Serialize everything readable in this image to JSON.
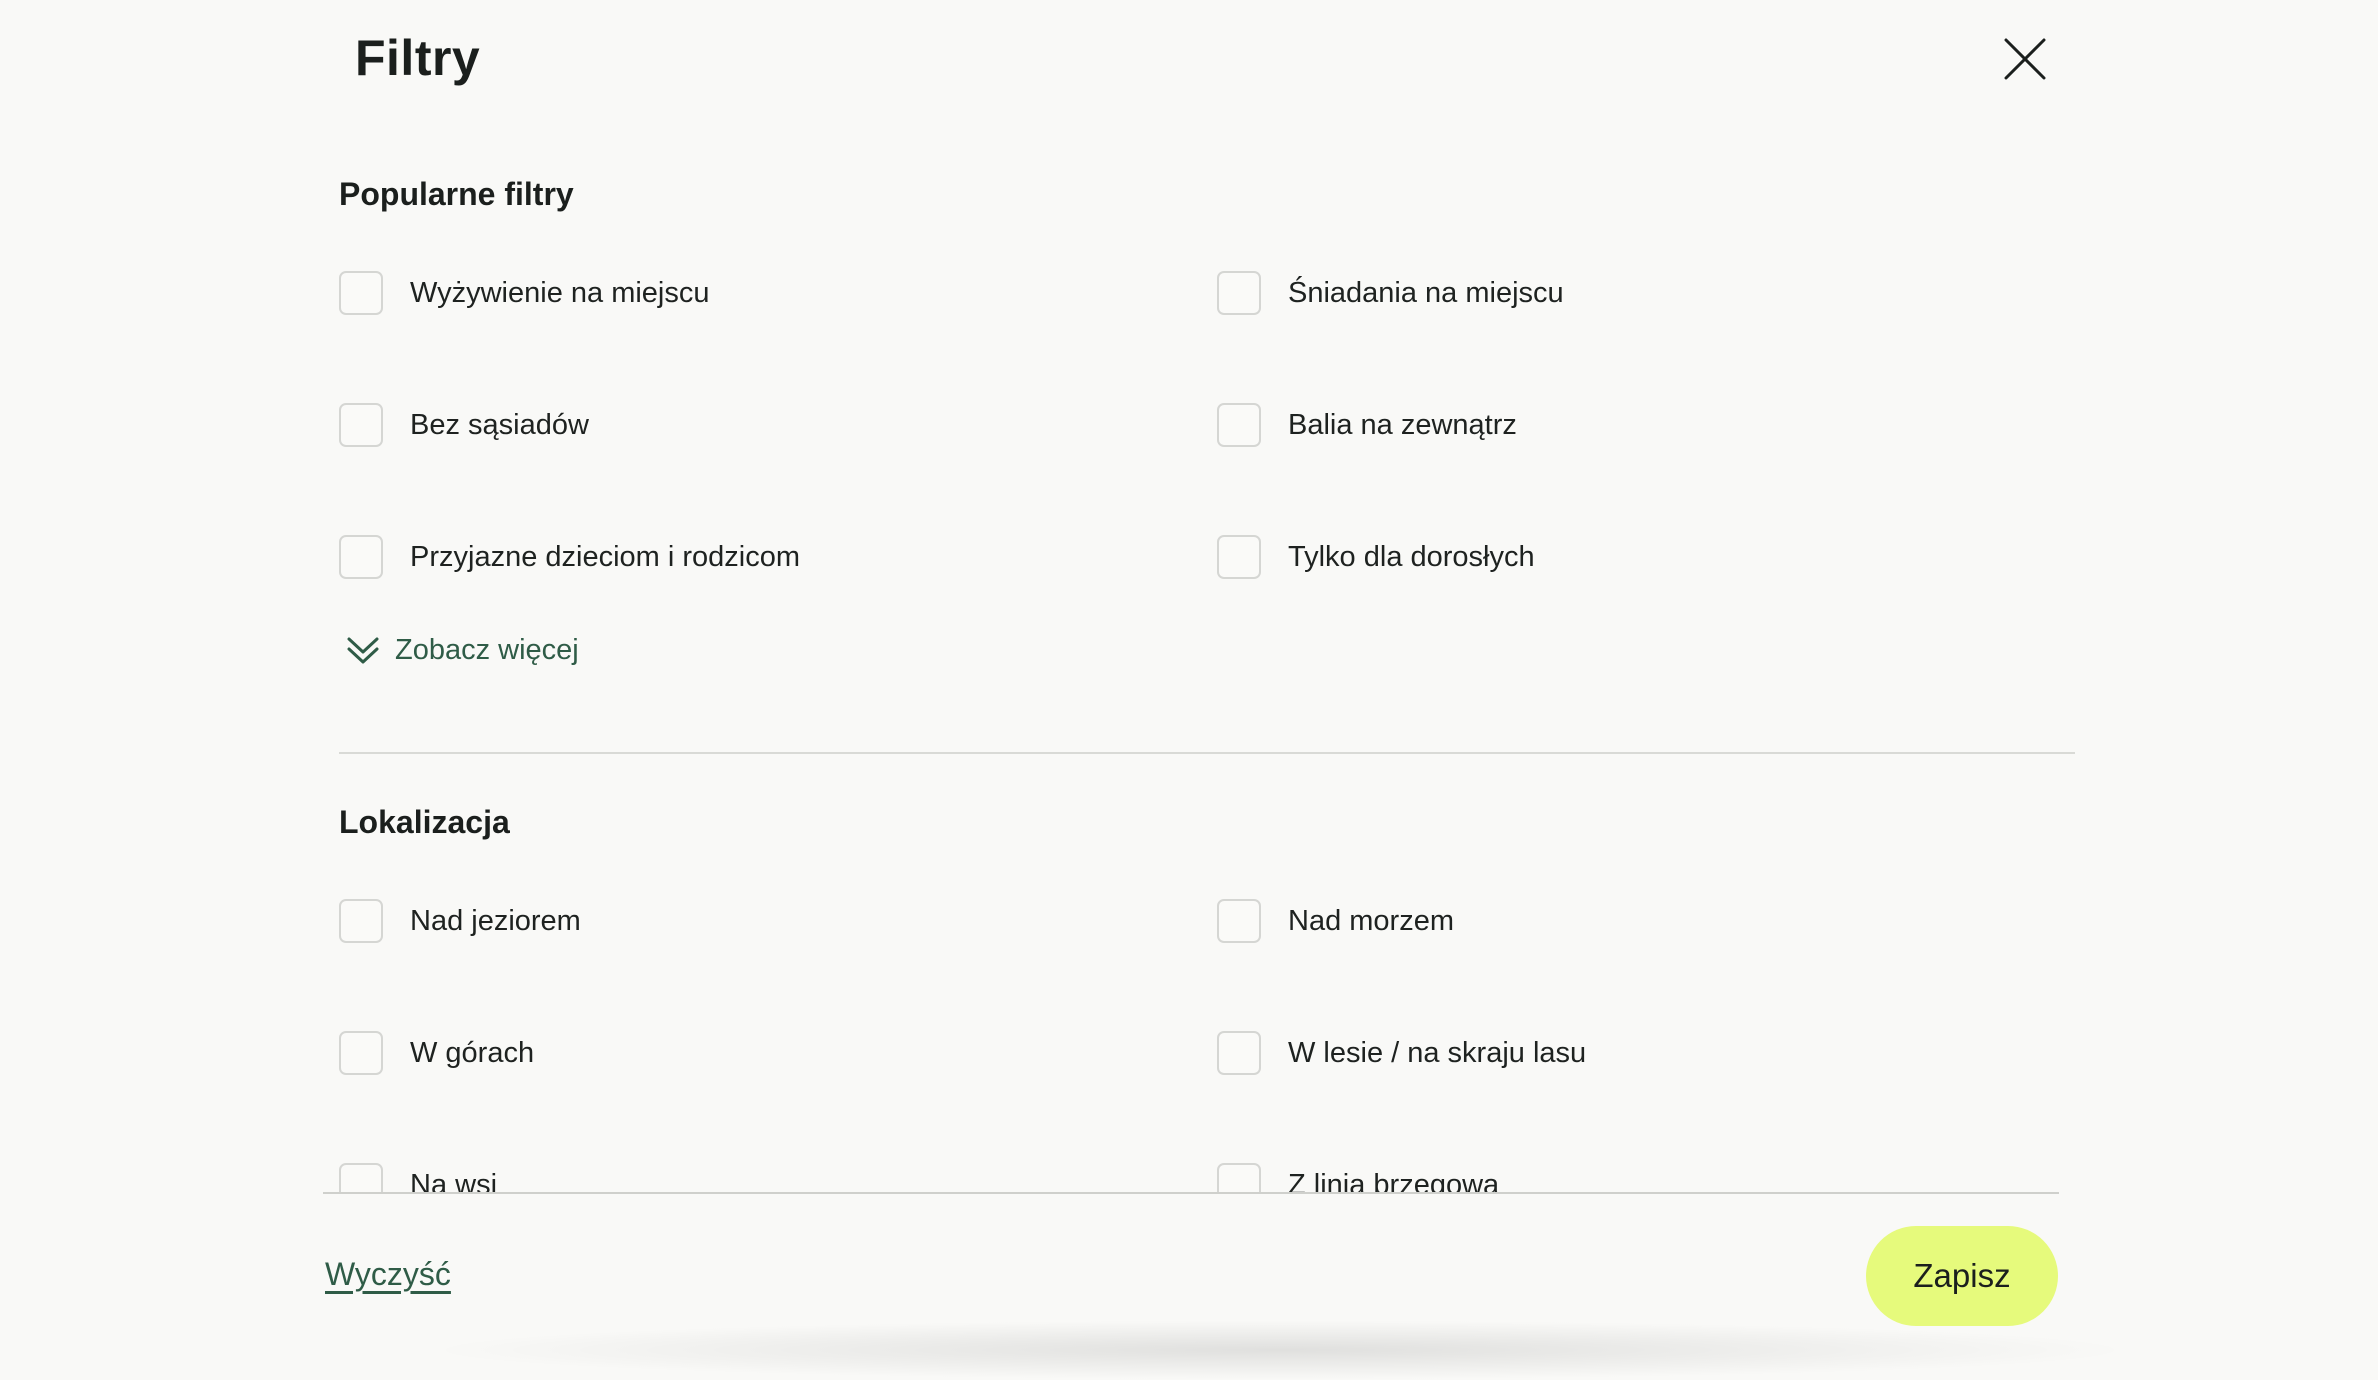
{
  "modal": {
    "title": "Filtry",
    "close_icon": "close-icon"
  },
  "sections": {
    "popular": {
      "title": "Popularne filtry",
      "options": [
        {
          "label": "Wyżywienie na miejscu",
          "checked": false
        },
        {
          "label": "Śniadania na miejscu",
          "checked": false
        },
        {
          "label": "Bez sąsiadów",
          "checked": false
        },
        {
          "label": "Balia na zewnątrz",
          "checked": false
        },
        {
          "label": "Przyjazne dzieciom i rodzicom",
          "checked": false
        },
        {
          "label": "Tylko dla dorosłych",
          "checked": false
        }
      ],
      "see_more": {
        "label": "Zobacz więcej",
        "icon": "double-chevron-down-icon"
      }
    },
    "location": {
      "title": "Lokalizacja",
      "options": [
        {
          "label": "Nad jeziorem",
          "checked": false
        },
        {
          "label": "Nad morzem",
          "checked": false
        },
        {
          "label": "W górach",
          "checked": false
        },
        {
          "label": "W lesie / na skraju lasu",
          "checked": false
        },
        {
          "label": "Na wsi",
          "checked": false
        },
        {
          "label": "Z linią brzegową",
          "checked": false
        }
      ]
    }
  },
  "footer": {
    "clear_label": "Wyczyść",
    "save_label": "Zapisz"
  },
  "colors": {
    "background": "#f9f9f7",
    "accent_button": "#e6fa7c",
    "link_green": "#2f5c47",
    "checkbox_border": "#d5d6d3"
  }
}
